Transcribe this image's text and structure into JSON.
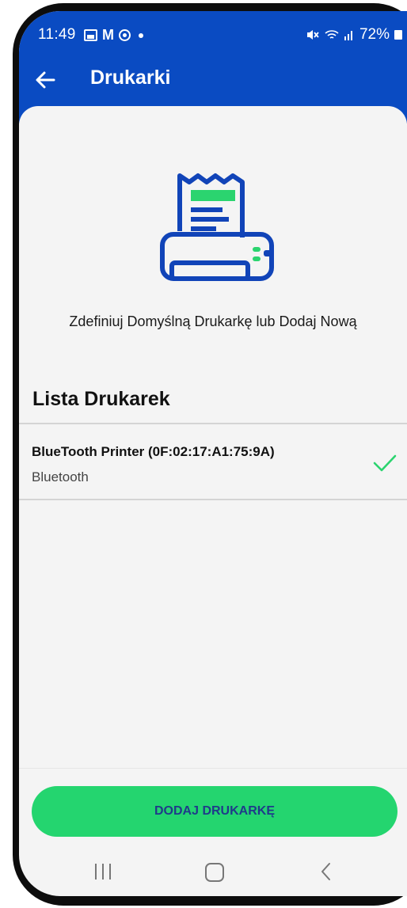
{
  "status_bar": {
    "time": "11:49",
    "battery": "72%",
    "icons": [
      "gallery-icon",
      "gmail-icon",
      "record-icon",
      "dot-icon",
      "mute-icon",
      "wifi-icon",
      "signal-icon",
      "battery-icon"
    ]
  },
  "header": {
    "title": "Drukarki",
    "back_icon": "arrow-left-icon"
  },
  "illustration": {
    "icon": "receipt-printer-icon",
    "colors": {
      "primary": "#1144b8",
      "accent": "#2bd46f"
    }
  },
  "main": {
    "subtitle": "Zdefiniuj Domyślną Drukarkę lub Dodaj Nową",
    "list_title": "Lista Drukarek",
    "printers": [
      {
        "name": "BlueTooth Printer (0F:02:17:A1:75:9A)",
        "type": "Bluetooth",
        "selected": true
      }
    ]
  },
  "actions": {
    "add_printer_label": "DODAJ DRUKARKĘ"
  },
  "colors": {
    "app_bar": "#0a4bc2",
    "button": "#24d56f",
    "button_text": "#1f3b8a",
    "check": "#2bd46f"
  }
}
